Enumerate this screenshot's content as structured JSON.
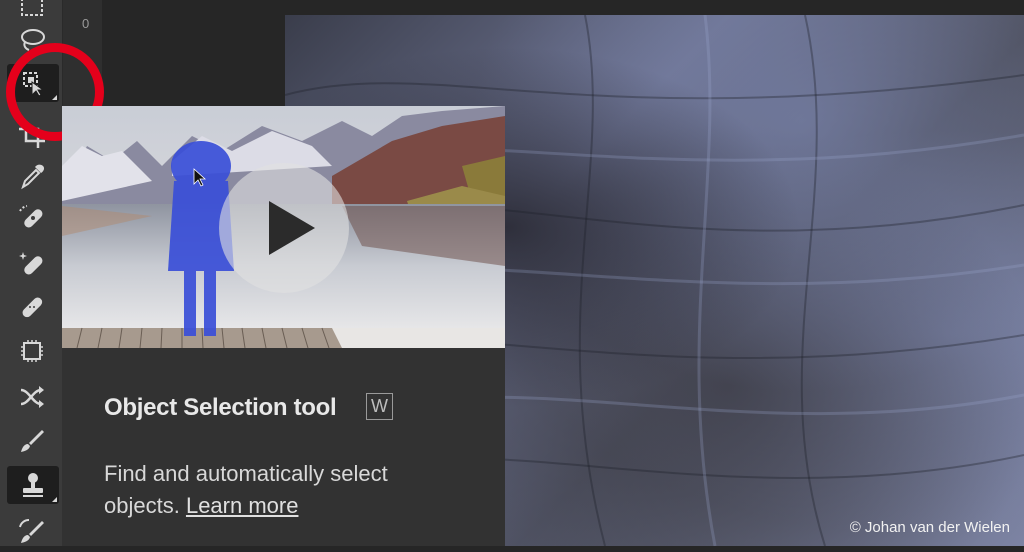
{
  "ruler": {
    "number": "0"
  },
  "toolbar": {
    "tools": [
      {
        "name": "rectangular-marquee-tool",
        "icon": "marquee-icon"
      },
      {
        "name": "lasso-tool",
        "icon": "lasso-icon"
      },
      {
        "name": "object-selection-tool",
        "icon": "object-selection-icon",
        "active": true
      },
      {
        "name": "crop-tool",
        "icon": "crop-icon"
      },
      {
        "name": "eyedropper-tool",
        "icon": "eyedropper-icon"
      },
      {
        "name": "spot-healing-brush-tool",
        "icon": "spot-healing-icon"
      },
      {
        "name": "remove-tool",
        "icon": "remove-tool-icon"
      },
      {
        "name": "healing-brush-tool",
        "icon": "bandage-icon"
      },
      {
        "name": "patch-tool",
        "icon": "patch-icon"
      },
      {
        "name": "content-aware-move-tool",
        "icon": "move-cross-icon"
      },
      {
        "name": "brush-tool",
        "icon": "brush-icon"
      },
      {
        "name": "clone-stamp-tool",
        "icon": "stamp-icon",
        "active": true
      },
      {
        "name": "history-brush-tool",
        "icon": "history-brush-icon"
      }
    ]
  },
  "tooltip": {
    "title": "Object Selection tool",
    "shortcut": "W",
    "description": "Find and automatically select objects.",
    "learn_more": "Learn more"
  },
  "canvas": {
    "copyright": "© Johan van der Wielen"
  },
  "colors": {
    "annotation": "#e4001b",
    "toolbar": "#3b3b3b",
    "tooltip_bg": "#323232"
  }
}
